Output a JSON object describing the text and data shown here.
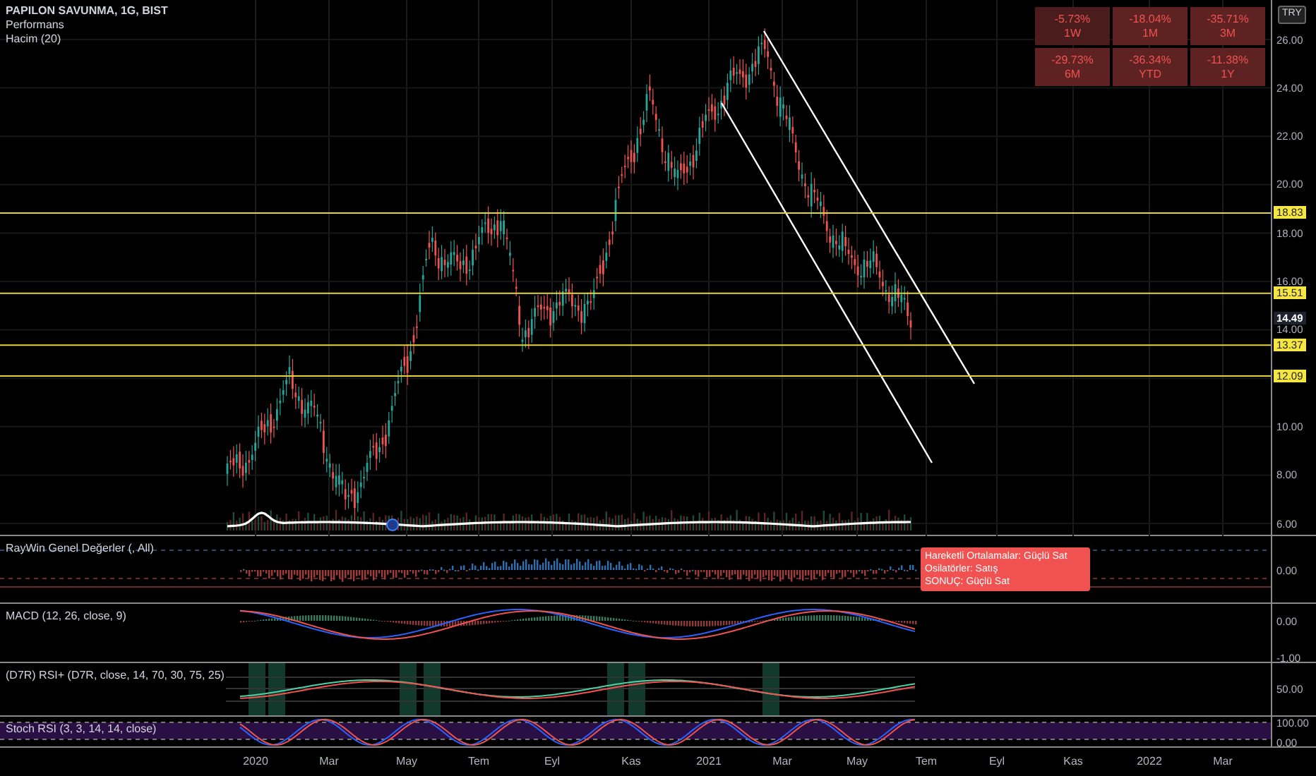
{
  "main": {
    "title": "PAPILON SAVUNMA, 1G, BIST",
    "legends": [
      "Performans",
      "Hacim (20)"
    ],
    "currency": "TRY",
    "performance": [
      {
        "value": "-5.73%",
        "period": "1W",
        "color": "#4a1c1c"
      },
      {
        "value": "-18.04%",
        "period": "1M",
        "color": "#5e2222"
      },
      {
        "value": "-35.71%",
        "period": "3M",
        "color": "#5e2222"
      },
      {
        "value": "-29.73%",
        "period": "6M",
        "color": "#5e2222"
      },
      {
        "value": "-36.34%",
        "period": "YTD",
        "color": "#5e2222"
      },
      {
        "value": "-11.38%",
        "period": "1Y",
        "color": "#5e2222"
      }
    ],
    "yticks": [
      "26.00",
      "24.00",
      "22.00",
      "20.00",
      "18.00",
      "16.00",
      "14.00",
      "10.00",
      "8.00",
      "6.00"
    ],
    "levels": [
      {
        "kind": "level",
        "label": "18.83"
      },
      {
        "kind": "level",
        "label": "15.51"
      },
      {
        "kind": "last",
        "label": "14.49"
      },
      {
        "kind": "level",
        "label": "13.37"
      },
      {
        "kind": "level",
        "label": "12.09"
      }
    ]
  },
  "panes": [
    {
      "kind": "raywin",
      "title": "RayWin Genel Değerler (, All)",
      "ticks": [
        "0.00"
      ]
    },
    {
      "kind": "macd",
      "title": "MACD (12, 26, close, 9)",
      "ticks": [
        "0.00",
        "-1.00"
      ]
    },
    {
      "kind": "rsi",
      "title": "(D7R) RSI+ (D7R, close, 14, 70, 30, 75, 25)",
      "ticks": [
        "50.00"
      ]
    },
    {
      "kind": "stoch",
      "title": "Stoch RSI (3, 3, 14, 14, close)",
      "ticks": [
        "100.00",
        "0.00"
      ]
    }
  ],
  "signal": {
    "lines": [
      {
        "label": "Hareketli Ortalamalar:",
        "value": "Güçlü Sat"
      },
      {
        "label": "Osilatörler:",
        "value": "Satış"
      },
      {
        "label": "SONUÇ:",
        "value": "Güçlü Sat"
      }
    ]
  },
  "time_axis": [
    "2020",
    "Mar",
    "May",
    "Tem",
    "Eyl",
    "Kas",
    "2021",
    "Mar",
    "May",
    "Tem",
    "Eyl",
    "Kas",
    "2022",
    "Mar"
  ]
}
